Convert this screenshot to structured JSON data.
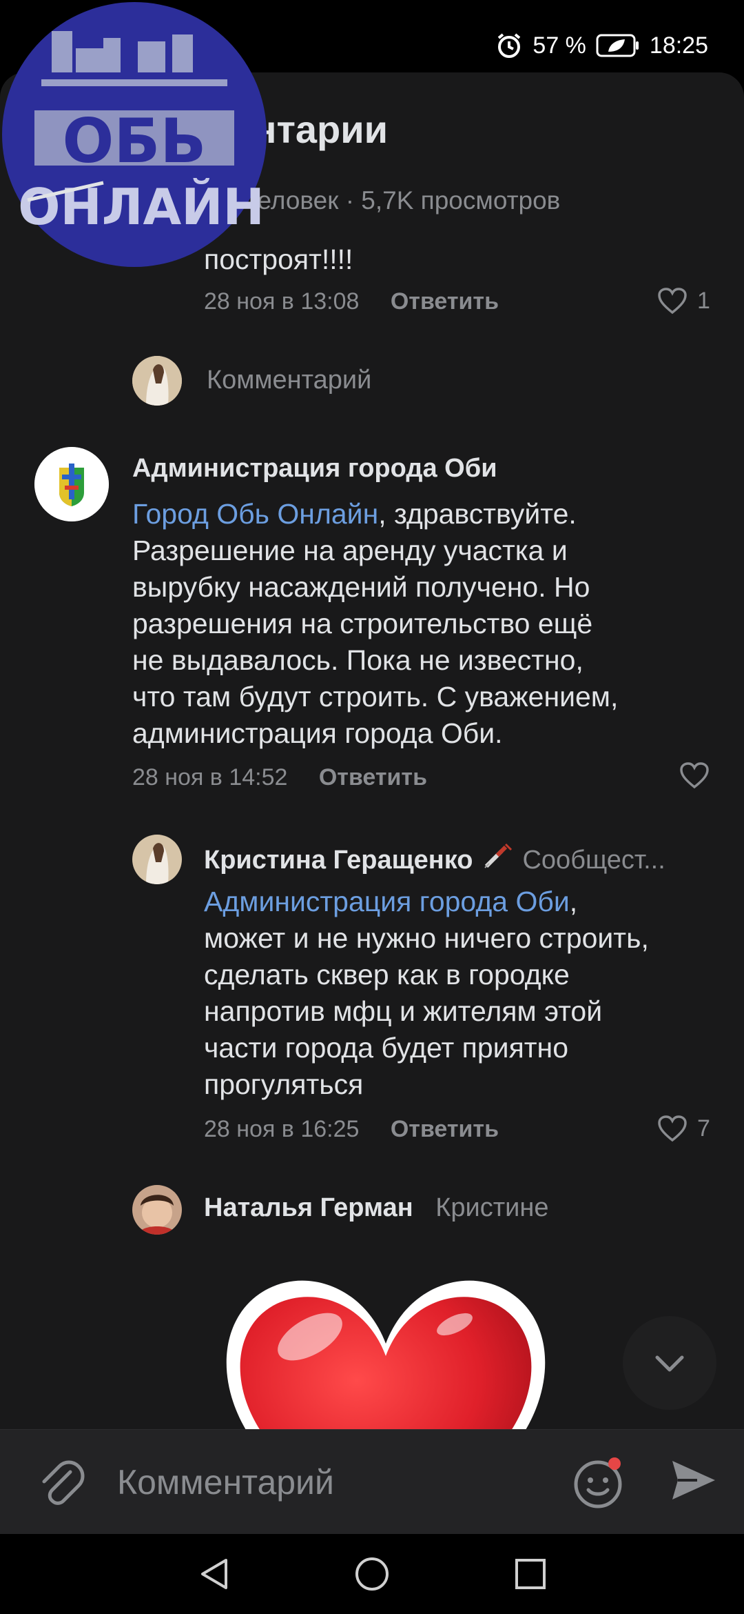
{
  "status": {
    "battery_percent": "57 %",
    "time": "18:25"
  },
  "header": {
    "title": "Комментарии",
    "subtitle": "Онлайн 35 человек · 5,7K просмотров"
  },
  "logo": {
    "line1": "ОБЬ",
    "line2": "ОНЛАЙН"
  },
  "comments": [
    {
      "tail_text": "построят!!!!",
      "date": "28 ноя в 13:08",
      "reply_label": "Ответить",
      "likes": "1"
    }
  ],
  "reply_prompt": {
    "placeholder": "Комментарий"
  },
  "admin_comment": {
    "author": "Администрация города Оби",
    "mention": "Город Обь Онлайн",
    "text_lines": [
      ", здравствуйте.",
      "Разрешение на аренду участка и",
      "вырубку насаждений получено. Но",
      "разрешения на строительство ещё",
      "не выдавалось. Пока не известно,",
      "что там будут строить. С уважением,",
      "администрация города Оби."
    ],
    "date": "28 ноя в 14:52",
    "reply_label": "Ответить"
  },
  "kristina_comment": {
    "author": "Кристина Геращенко",
    "community": "Сообщест...",
    "mention": "Администрация города Оби",
    "text_lines": [
      ",",
      "может и не нужно ничего строить,",
      "сделать сквер как в городке",
      "напротив мфц и жителям этой",
      "части города будет приятно",
      "прогуляться"
    ],
    "date": "28 ноя в 16:25",
    "reply_label": "Ответить",
    "likes": "7"
  },
  "natalia_comment": {
    "author": "Наталья Герман",
    "reply_to": "Кристине"
  },
  "compose": {
    "placeholder": "Комментарий"
  },
  "colors": {
    "background": "#19191a",
    "link": "#6c9ee0",
    "secondary": "#8a8c90",
    "heart": "#e0202a"
  },
  "icons": [
    "close-icon",
    "heart-outline-icon",
    "chevron-down-icon",
    "paperclip-icon",
    "emoji-icon",
    "send-icon",
    "back-triangle-icon",
    "home-circle-icon",
    "recents-square-icon",
    "alarm-icon",
    "battery-icon"
  ]
}
